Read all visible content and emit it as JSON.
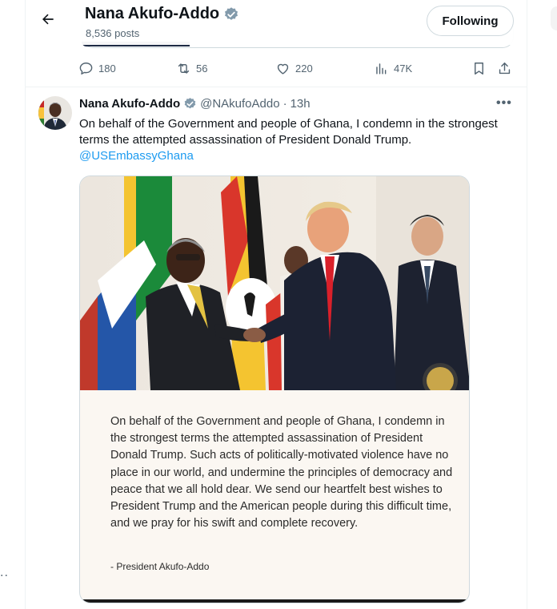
{
  "header": {
    "name": "Nana Akufo-Addo",
    "posts_count": "8,536 posts",
    "follow_label": "Following"
  },
  "actions": {
    "replies": "180",
    "reposts": "56",
    "likes": "220",
    "views": "47K"
  },
  "tweet": {
    "name": "Nana Akufo-Addo",
    "handle": "@NAkufoAddo",
    "separator": "·",
    "time": "13h",
    "more": "•••",
    "text": "On behalf of the Government and people of Ghana, I condemn in the strongest terms the attempted assassination of President Donald Trump.",
    "mention": "@USEmbassyGhana",
    "card_text": "On behalf of the Government and people of Ghana, I condemn in the strongest terms the attempted assassination of President Donald Trump. Such acts of politically-motivated violence have no place in our world, and undermine the principles of democracy and peace that we all hold dear. We send our heartfelt best wishes to President Trump and the American people during this difficult time, and we pray for his swift and complete recovery.",
    "card_signature": "- President Akufo-Addo"
  },
  "sidebar_fragment": "..",
  "colors": {
    "link": "#1d9bf0",
    "verified": "#829aab",
    "secondary_text": "#536471",
    "border": "#cfd9de"
  }
}
